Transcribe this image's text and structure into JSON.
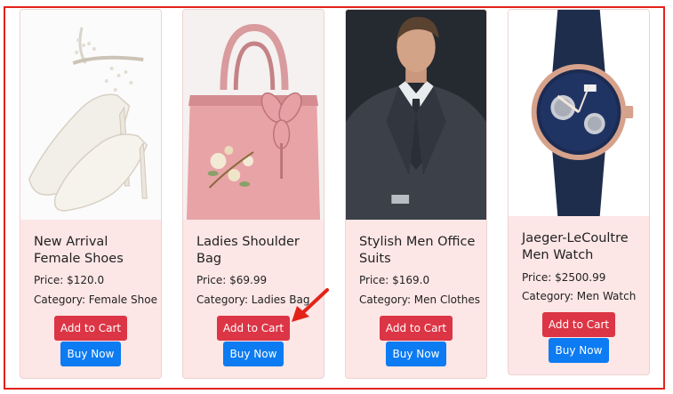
{
  "products": [
    {
      "name": "New Arrival Female Shoes",
      "price": "Price: $120.0",
      "category": "Category: Female Shoe",
      "image": "white-heels-image",
      "add_label": "Add to Cart",
      "buy_label": "Buy Now"
    },
    {
      "name": "Ladies Shoulder Bag",
      "price": "Price: $69.99",
      "category": "Category: Ladies Bag",
      "image": "pink-handbag-image",
      "add_label": "Add to Cart",
      "buy_label": "Buy Now"
    },
    {
      "name": "Stylish Men Office Suits",
      "price": "Price: $169.0",
      "category": "Category: Men Clothes",
      "image": "man-in-suit-image",
      "add_label": "Add to Cart",
      "buy_label": "Buy Now"
    },
    {
      "name": "Jaeger-LeCoultre Men Watch",
      "price": "Price: $2500.99",
      "category": "Category: Men Watch",
      "image": "wrist-watch-image",
      "add_label": "Add to Cart",
      "buy_label": "Buy Now"
    }
  ],
  "colors": {
    "card_bg": "#fde6e6",
    "add_button": "#dc3545",
    "buy_button": "#0d7bf2",
    "frame": "#e2231a",
    "arrow": "#e2231a"
  },
  "annotation": {
    "icon": "red-arrow-icon",
    "points_to": "Add to Cart"
  }
}
